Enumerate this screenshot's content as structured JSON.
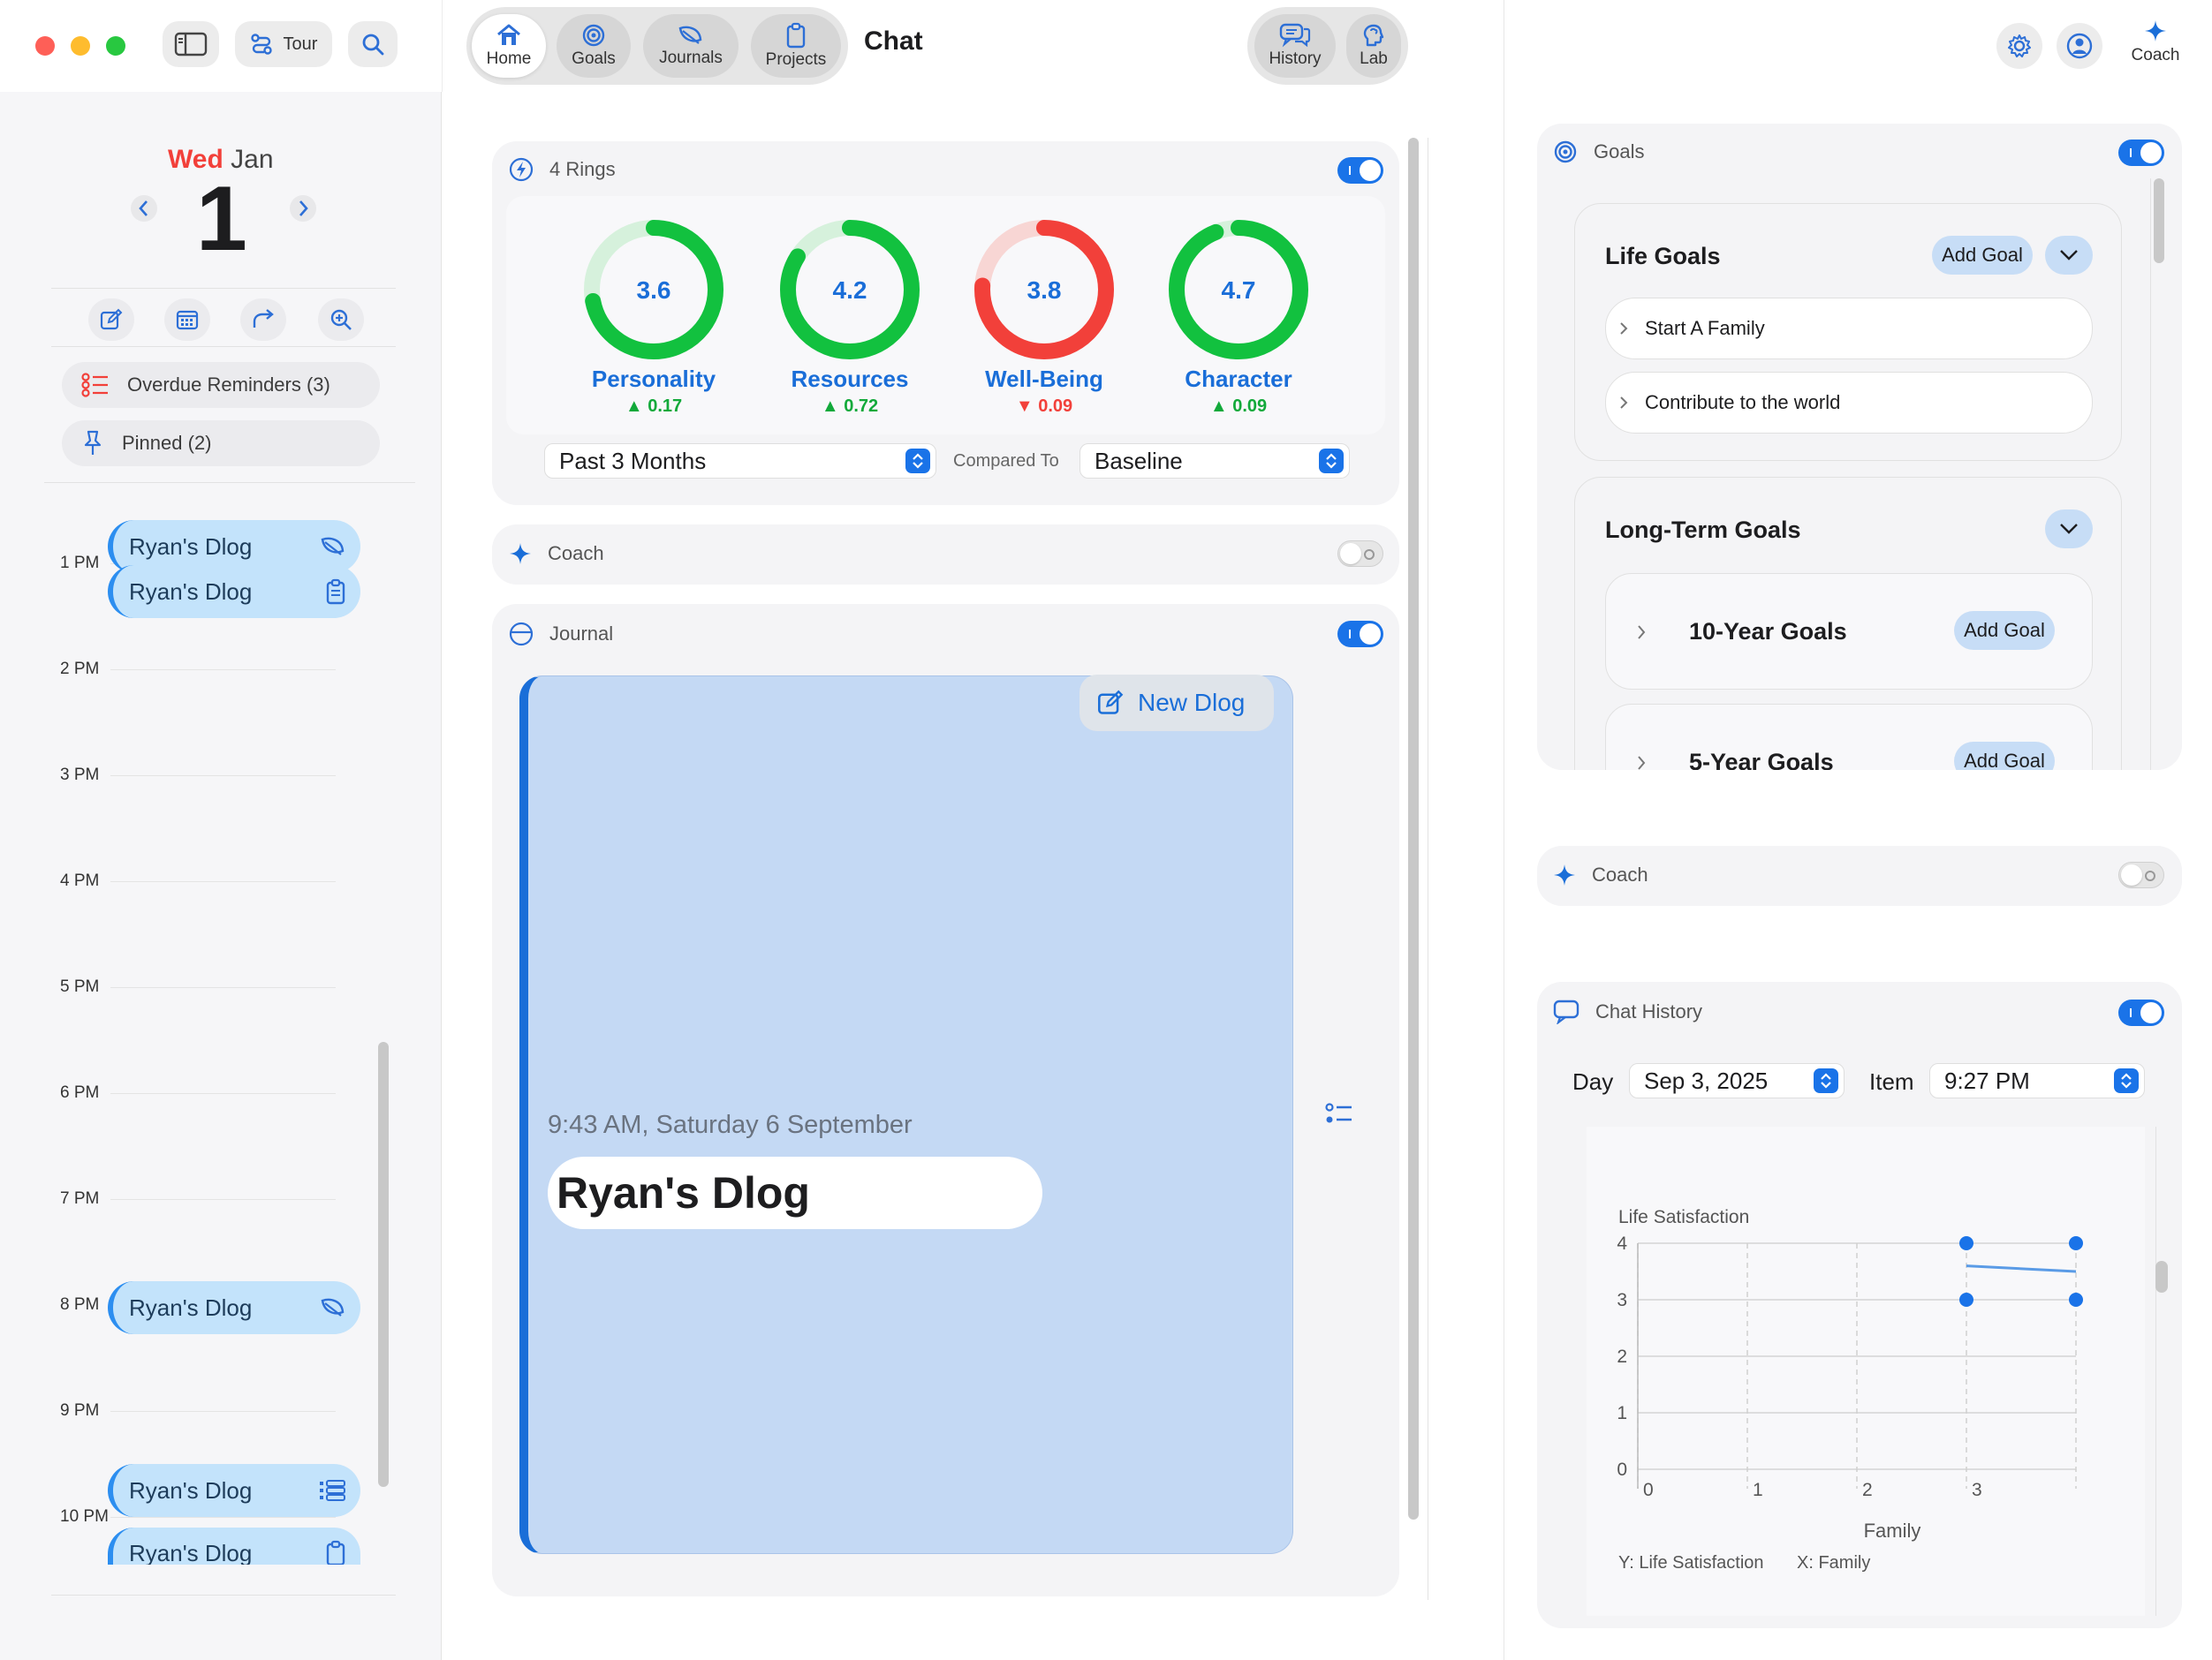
{
  "header": {
    "tour_label": "Tour",
    "nav": [
      {
        "label": "Home"
      },
      {
        "label": "Goals"
      },
      {
        "label": "Journals"
      },
      {
        "label": "Projects"
      }
    ],
    "page_title": "Chat",
    "history_label": "History",
    "lab_label": "Lab",
    "coach_label": "Coach"
  },
  "sidebar": {
    "weekday": "Wed",
    "month": "Jan",
    "day": "1",
    "overdue_label": "Overdue Reminders (3)",
    "pinned_label": "Pinned (2)",
    "hours": [
      "1 PM",
      "2 PM",
      "3 PM",
      "4 PM",
      "5 PM",
      "6 PM",
      "7 PM",
      "8 PM",
      "9 PM",
      "10 PM"
    ],
    "events": [
      {
        "title": "Ryan's Dlog",
        "icon": "leaf-icon"
      },
      {
        "title": "Ryan's Dlog",
        "icon": "clipboard-icon"
      },
      {
        "title": "Ryan's Dlog",
        "icon": "leaf-icon"
      },
      {
        "title": "Ryan's Dlog",
        "icon": "list-icon"
      },
      {
        "title": "Ryan's Dlog",
        "icon": "clipboard-icon"
      }
    ]
  },
  "rings": {
    "title": "4 Rings",
    "items": [
      {
        "value": "3.6",
        "label": "Personality",
        "delta": "0.17",
        "direction": "up",
        "fraction": 0.72,
        "color": "#12c13f",
        "track": "#d6f1dc"
      },
      {
        "value": "4.2",
        "label": "Resources",
        "delta": "0.72",
        "direction": "up",
        "fraction": 0.84,
        "color": "#12c13f",
        "track": "#d6f1dc"
      },
      {
        "value": "3.8",
        "label": "Well-Being",
        "delta": "0.09",
        "direction": "down",
        "fraction": 0.76,
        "color": "#f2403a",
        "track": "#f8d6d4"
      },
      {
        "value": "4.7",
        "label": "Character",
        "delta": "0.09",
        "direction": "up",
        "fraction": 0.94,
        "color": "#12c13f",
        "track": "#d6f1dc"
      }
    ],
    "period_value": "Past 3 Months",
    "compared_label": "Compared To",
    "compared_value": "Baseline"
  },
  "coach_card": {
    "title": "Coach"
  },
  "journal": {
    "title": "Journal",
    "new_button": "New Dlog",
    "timestamp": "9:43 AM, Saturday 6 September",
    "entry_title": "Ryan's Dlog"
  },
  "goals_panel": {
    "title": "Goals",
    "life_goals": {
      "title": "Life Goals",
      "add_label": "Add Goal",
      "items": [
        "Start A Family",
        "Contribute to the world"
      ]
    },
    "long_term": {
      "title": "Long-Term Goals",
      "groups": [
        {
          "title": "10-Year Goals",
          "add_label": "Add Goal"
        },
        {
          "title": "5-Year Goals",
          "add_label": "Add Goal"
        }
      ]
    }
  },
  "right_coach": {
    "title": "Coach"
  },
  "chat_history": {
    "title": "Chat History",
    "day_label": "Day",
    "day_value": "Sep 3, 2025",
    "item_label": "Item",
    "item_value": "9:27 PM",
    "chart_data": {
      "type": "line",
      "title": "",
      "ylabel": "Life Satisfaction",
      "xlabel": "Family",
      "x_ticks": [
        "0",
        "1",
        "2",
        "3"
      ],
      "y_ticks": [
        "0",
        "1",
        "2",
        "3",
        "4"
      ],
      "xlim": [
        0,
        4
      ],
      "ylim": [
        0,
        4
      ],
      "points": [
        [
          3,
          4
        ],
        [
          4,
          4
        ],
        [
          3,
          3
        ],
        [
          4,
          3
        ]
      ],
      "line": [
        [
          3,
          3.6
        ],
        [
          4,
          3.5
        ]
      ],
      "legend": [
        "Y: Life Satisfaction",
        "X: Family"
      ],
      "grid": true,
      "color": "#1a73e8"
    }
  }
}
